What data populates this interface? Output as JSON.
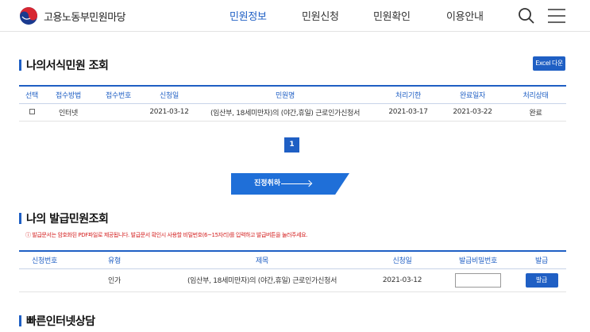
{
  "header": {
    "logo_text": "고용노동부민원마당",
    "nav": [
      "민원정보",
      "민원신청",
      "민원확인",
      "이용안내"
    ],
    "active_nav": "민원정보"
  },
  "my_forms": {
    "title": "나의서식민원 조회",
    "excel_button": "Excel 다운",
    "columns": [
      "선택",
      "접수방법",
      "접수번호",
      "신청일",
      "민원명",
      "처리기한",
      "완료일자",
      "처리상태"
    ],
    "rows": [
      {
        "method": "인터넷",
        "receipt_no": "",
        "apply_date": "2021-03-12",
        "name": "(임산부, 18세미만자)의 (야간,휴일) 근로인가신청서",
        "deadline": "2021-03-17",
        "done_date": "2021-03-22",
        "status": "완료"
      }
    ],
    "current_page": "1",
    "cancel_button": "진정취하"
  },
  "my_issues": {
    "title": "나의 발급민원조회",
    "notice": "ⓘ 발급문서는 암호화된 PDF파일로 제공됩니다. 발급문서 확인시 사용할 비밀번호(6~15자리)를 입력하고 발급버튼을 눌러주세요.",
    "columns": [
      "신청번호",
      "유형",
      "제목",
      "신청일",
      "발급비밀번호",
      "발급"
    ],
    "rows": [
      {
        "apply_no": "",
        "type": "인가",
        "subject": "(임산부, 18세미만자)의 (야간,휴일) 근로인가신청서",
        "apply_date": "2021-03-12",
        "password": "",
        "issue_button": "발급"
      }
    ]
  },
  "quick": {
    "title": "빠른인터넷상담"
  },
  "colors": {
    "accent": "#1f5fc4",
    "notice": "#d42020"
  }
}
